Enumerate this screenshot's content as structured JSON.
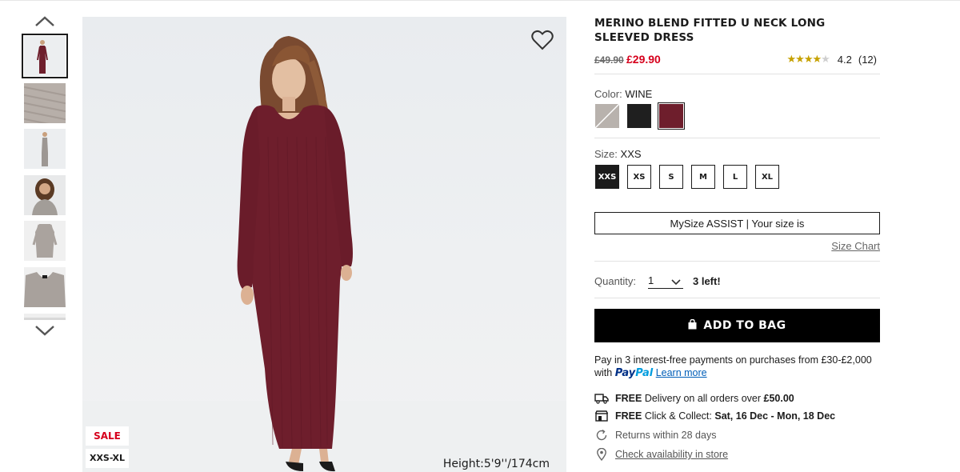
{
  "product": {
    "title": "MERINO BLEND FITTED U NECK LONG SLEEVED DRESS",
    "price_old": "£49.90",
    "price_new": "£29.90",
    "rating_value": "4.2",
    "rating_count": "(12)",
    "rating_stars": 4.2
  },
  "image": {
    "badge_sale": "SALE",
    "badge_sizes": "XXS-XL",
    "height_caption": "Height:5'9''/174cm"
  },
  "color": {
    "label": "Color:",
    "selected": "WINE",
    "swatches": [
      {
        "name": "grey",
        "hex": "#b8b2ad"
      },
      {
        "name": "black",
        "hex": "#1f1f1f"
      },
      {
        "name": "wine",
        "hex": "#6e1e2c"
      }
    ]
  },
  "size": {
    "label": "Size:",
    "selected": "XXS",
    "options": [
      "XXS",
      "XS",
      "S",
      "M",
      "L",
      "XL"
    ]
  },
  "mysize": {
    "label": "MySize ASSIST | Your size is"
  },
  "size_chart": {
    "label": "Size Chart"
  },
  "quantity": {
    "label": "Quantity:",
    "value": "1",
    "stock": "3 left!"
  },
  "add_to_bag": {
    "label": "ADD TO BAG"
  },
  "paypal": {
    "line1": "Pay in 3 interest-free payments on purchases from £30-£2,000",
    "with": "with",
    "logo_pay": "Pay",
    "logo_pal": "Pal",
    "learn_more": "Learn more"
  },
  "delivery": {
    "free1": "FREE",
    "text1": "Delivery on all orders over",
    "amount": "£50.00",
    "free2": "FREE",
    "text2": "Click & Collect:",
    "dates": "Sat, 16 Dec - Mon, 18 Dec",
    "returns": "Returns within 28 days",
    "availability": "Check availability in store"
  },
  "colors": {
    "sale_red": "#d6001c",
    "dress": "#6e1e2c",
    "button_black": "#000000"
  }
}
